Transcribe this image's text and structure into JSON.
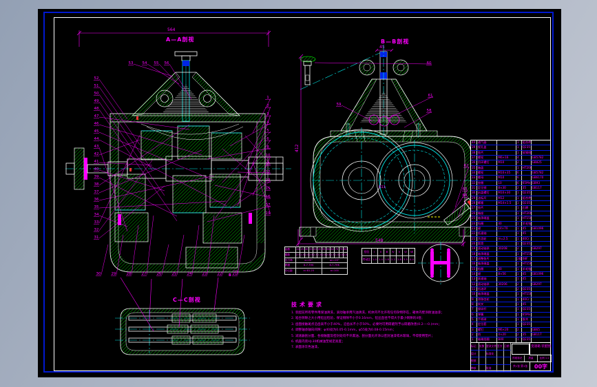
{
  "colors": {
    "canvas": "#000000",
    "border_blue": "#0018d0",
    "frame_white": "#ffffff",
    "line_green": "#00c800",
    "line_cyan": "#00e8e8",
    "line_magenta": "#ff00ff",
    "accent_red": "#ff3333",
    "accent_blue": "#0026e6",
    "accent_yellow": "#ffff00"
  },
  "views": {
    "left": {
      "label": "A—A剖视",
      "dim_top": "564"
    },
    "right": {
      "label": "B—B剖视",
      "dim_bottom": "548",
      "dim_left": "412",
      "small_dim": "45",
      "radius_label": "R11"
    },
    "section_c": {
      "label": "C—C剖视"
    },
    "section_mark": "B"
  },
  "balloons": {
    "left_col": [
      "52",
      "51",
      "50",
      "49",
      "48",
      "47",
      "46",
      "45",
      "44",
      "43",
      "42",
      "41",
      "40",
      "39",
      "38",
      "37",
      "36",
      "35",
      "34",
      "33",
      "32",
      "31"
    ],
    "top_row": [
      "53",
      "54",
      "55",
      "56"
    ],
    "right_col": [
      "1",
      "2",
      "3",
      "4",
      "5",
      "6",
      "8",
      "10",
      "11",
      "12",
      "13",
      "15",
      "16",
      "17",
      "19"
    ],
    "bottom_row": [
      "30",
      "29",
      "28",
      "27",
      "26",
      "25",
      "24",
      "23",
      "22",
      "21"
    ],
    "right_view": [
      "60",
      "61",
      "59",
      "58",
      "62",
      "63",
      "64"
    ]
  },
  "notes": {
    "title": "技术要求",
    "items": [
      "装配前所有零件用煤油清洗，滚动轴承用汽油清洗，机体内不允许有任何杂物存在，箱体内壁涂耐油油漆；",
      "啮合侧隙之大小用铅丝检验，保证侧隙不小于0.16mm，铅丝直径不得大于最小侧隙的4倍；",
      "齿面接触斑点沿齿高不小于40%，沿齿长不小于50%，必要时可用研磨剂予以研磨改善(0.2----0.)mm；",
      "调整轴承轴向间隙：φ40处为0.05-0.1mm，φ55处为0.08-0.15mm；",
      "减速器剖分面、各接触面及密封处均不许漏油，剖分面允许涂以密封油漆或水玻璃，不得使用垫片；",
      "机座内装HJ-30机械油至规定高度；",
      "表面涂灰色油漆。"
    ]
  },
  "gear_table": {
    "rows": [
      {
        "label": "齿数",
        "cells": [
          "20",
          "25",
          "30",
          "35",
          "40",
          "45",
          "50",
          "56",
          "62",
          "70",
          "79",
          "88"
        ]
      },
      {
        "label": "模数",
        "cells": [
          "2.5",
          "2.5",
          "2.5",
          "2.5",
          "2.5",
          "2.5",
          "2.5",
          "2.5",
          "2.5",
          "2.5",
          "2.5",
          "2.5"
        ]
      },
      {
        "label": "压力角",
        "cells": [
          "α=20°",
          "αn=20°"
        ]
      },
      {
        "label": "精度",
        "cells": [
          "8-7-7HK",
          "8-7-7HK"
        ]
      },
      {
        "label": "中心距",
        "cells": [
          "a=81.25",
          "a=100"
        ]
      }
    ]
  },
  "ratio_table": {
    "rows": [
      [
        "挡位",
        "Ⅰ",
        "Ⅱ",
        "Ⅲ",
        "Ⅳ",
        "Ⅴ",
        "Ⅵ",
        "Ⅶ"
      ],
      [
        "传动比",
        "1.0",
        "1.4",
        "1.8",
        "2.2",
        "2.8",
        "3.5",
        "4.4"
      ]
    ]
  },
  "bom": {
    "rows": [
      [
        "40",
        "通气器",
        "",
        "1",
        "组合件",
        ""
      ],
      [
        "39",
        "视孔盖",
        "",
        "1",
        "Q235",
        ""
      ],
      [
        "38",
        "垫片",
        "",
        "1",
        "软钢纸板",
        ""
      ],
      [
        "37",
        "螺栓",
        "M6×16",
        "4",
        "",
        "GB5782"
      ],
      [
        "36",
        "吊环螺钉",
        "M10",
        "2",
        "",
        "GB825"
      ],
      [
        "35",
        "箱盖",
        "",
        "1",
        "HT200",
        ""
      ],
      [
        "34",
        "螺栓",
        "M10×35",
        "6",
        "",
        "GB5782"
      ],
      [
        "33",
        "螺母",
        "M10",
        "6",
        "",
        "GB6170"
      ],
      [
        "32",
        "垫圈",
        "10",
        "6",
        "65Mn",
        "GB93"
      ],
      [
        "31",
        "定位销",
        "8×30",
        "2",
        "35",
        "GB117"
      ],
      [
        "30",
        "启盖螺钉",
        "M10×30",
        "1",
        "Q235",
        ""
      ],
      [
        "29",
        "油标尺",
        "M12",
        "1",
        "组合件",
        ""
      ],
      [
        "28",
        "螺塞",
        "M14×1.5",
        "1",
        "Q235",
        ""
      ],
      [
        "27",
        "垫片",
        "",
        "1",
        "石棉",
        ""
      ],
      [
        "26",
        "箱座",
        "",
        "1",
        "HT200",
        ""
      ],
      [
        "25",
        "轴承端盖",
        "",
        "1",
        "HT150",
        ""
      ],
      [
        "24",
        "毡圈",
        "40",
        "1",
        "羊毛毡",
        ""
      ],
      [
        "23",
        "键",
        "14×70",
        "1",
        "45",
        "GB1096"
      ],
      [
        "22",
        "低速轴",
        "",
        "1",
        "45",
        ""
      ],
      [
        "21",
        "大齿轮",
        "m=2.5",
        "1",
        "40Cr",
        ""
      ],
      [
        "20",
        "套筒",
        "",
        "1",
        "Q235",
        ""
      ],
      [
        "19",
        "滚动轴承",
        "30208",
        "2",
        "",
        "GB297"
      ],
      [
        "18",
        "轴承端盖",
        "",
        "1",
        "HT150",
        ""
      ],
      [
        "17",
        "调整垫片",
        "",
        "2组",
        "08F",
        ""
      ],
      [
        "16",
        "轴承端盖",
        "",
        "1",
        "HT150",
        ""
      ],
      [
        "15",
        "毡圈",
        "30",
        "1",
        "羊毛毡",
        ""
      ],
      [
        "14",
        "键",
        "8×56",
        "1",
        "45",
        "GB1096"
      ],
      [
        "13",
        "高速轴",
        "",
        "1",
        "45",
        ""
      ],
      [
        "12",
        "滚动轴承",
        "30206",
        "2",
        "",
        "GB297"
      ],
      [
        "11",
        "挡油环",
        "",
        "2",
        "Q235",
        ""
      ],
      [
        "10",
        "轴承端盖",
        "",
        "1",
        "HT150",
        ""
      ],
      [
        "9",
        "滑移齿轮",
        "",
        "1",
        "40Cr",
        ""
      ],
      [
        "8",
        "拨叉",
        "",
        "1",
        "45",
        ""
      ],
      [
        "7",
        "操纵杆",
        "",
        "1",
        "Q235",
        ""
      ],
      [
        "6",
        "弹簧",
        "",
        "1",
        "65Mn",
        ""
      ],
      [
        "5",
        "手柄球",
        "",
        "1",
        "胶木",
        ""
      ],
      [
        "4",
        "定位套",
        "",
        "1",
        "Q235",
        ""
      ],
      [
        "3",
        "螺钉",
        "M6×20",
        "2",
        "",
        "GB65"
      ],
      [
        "2",
        "销",
        "4×20",
        "2",
        "35",
        "GB117"
      ],
      [
        "1",
        "轴端挡圈",
        "B40",
        "1",
        "Q235",
        ""
      ]
    ]
  },
  "title_block": {
    "left_rows": [
      [
        "标记",
        "处数",
        "更改文件号",
        "签字",
        "日期"
      ],
      [
        "设计",
        "",
        "标准化",
        "",
        ""
      ],
      [
        "校核",
        "",
        "",
        "",
        ""
      ],
      [
        "审核",
        "",
        "批准",
        "",
        ""
      ]
    ],
    "drawing_name": "变速箱 装配图",
    "mid_labels": [
      "阶段标记",
      "质量",
      "比例"
    ],
    "mid_values": [
      "",
      "",
      "1:2"
    ],
    "sheet": "共1张 第1张",
    "code": "00字"
  }
}
